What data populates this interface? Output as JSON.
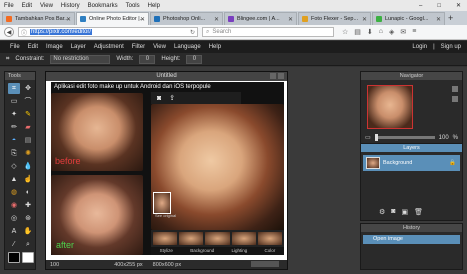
{
  "browser": {
    "menu": [
      "File",
      "Edit",
      "View",
      "History",
      "Bookmarks",
      "Tools",
      "Help"
    ],
    "tabs": [
      {
        "label": "Tambahkan Pos Bar...",
        "active": false,
        "color": "#f36b21"
      },
      {
        "label": "Online Photo Editor |...",
        "active": true,
        "color": "#2f7fc1"
      },
      {
        "label": "Photoshop Onli...",
        "active": false,
        "color": "#1d6fb8"
      },
      {
        "label": "Blingee.com | A...",
        "active": false,
        "color": "#7a3fbf"
      },
      {
        "label": "Foto Flexer - Sep...",
        "active": false,
        "color": "#e0a020"
      },
      {
        "label": "Lunapic - Googl...",
        "active": false,
        "color": "#3cb043"
      }
    ],
    "url": "https://pixlr.com/editor/",
    "search_placeholder": "Search"
  },
  "app": {
    "menu": [
      "File",
      "Edit",
      "Image",
      "Layer",
      "Adjustment",
      "Filter",
      "View",
      "Language",
      "Help"
    ],
    "login": "Login",
    "signup": "Sign up",
    "options": {
      "constraint_label": "Constraint:",
      "constraint_value": "No restriction",
      "width_label": "Width:",
      "width_value": "0",
      "height_label": "Height:",
      "height_value": "0"
    },
    "tools_title": "Tools",
    "document": {
      "title": "Untitled",
      "caption": "Aplikasi edit foto make up untuk Android dan iOS terpopule",
      "before": "before",
      "after": "after",
      "zoom": "100",
      "dims": "400x255 px",
      "canvas_size": "800x600 px",
      "mini_tabs": [
        "Stylize",
        "Background",
        "Lighting",
        "Color"
      ],
      "inset_label": "See original"
    },
    "navigator": {
      "title": "Navigator",
      "zoom": "100",
      "zoom_unit": "%",
      "zoom_level": 0.01
    },
    "layers": {
      "title": "Layers",
      "items": [
        "Background"
      ]
    },
    "history": {
      "title": "History",
      "items": [
        "Open image"
      ]
    }
  }
}
